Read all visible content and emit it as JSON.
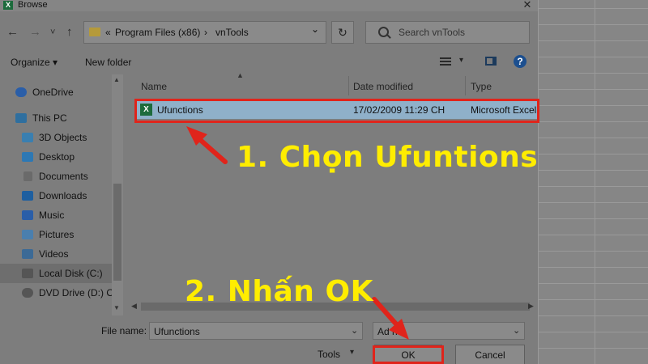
{
  "window": {
    "title": "Browse",
    "app_icon": "excel-icon",
    "close_glyph": "✕"
  },
  "nav": {
    "back": "←",
    "forward": "→",
    "recent": "˅",
    "up": "↑"
  },
  "address": {
    "prefix": "«",
    "crumbs": [
      "Program Files (x86)",
      "vnTools"
    ],
    "separator": "›",
    "dropdown": "⌄"
  },
  "refresh_glyph": "↻",
  "search": {
    "placeholder": "Search vnTools"
  },
  "toolbar": {
    "organize": "Organize ▾",
    "new_folder": "New folder",
    "help": "?"
  },
  "sidebar": {
    "items": [
      {
        "label": "OneDrive",
        "icon": "cloud-icon",
        "color": "#2a5ea8"
      },
      {
        "label": "This PC",
        "icon": "computer-icon",
        "color": "#2f6f9f"
      },
      {
        "label": "3D Objects",
        "icon": "cube-icon",
        "color": "#3a7fb0"
      },
      {
        "label": "Desktop",
        "icon": "desktop-icon",
        "color": "#2d78b4"
      },
      {
        "label": "Documents",
        "icon": "document-icon",
        "color": "#6a6a6a"
      },
      {
        "label": "Downloads",
        "icon": "download-icon",
        "color": "#1e5fa0"
      },
      {
        "label": "Music",
        "icon": "music-icon",
        "color": "#2a5ea8"
      },
      {
        "label": "Pictures",
        "icon": "pictures-icon",
        "color": "#4a7fae"
      },
      {
        "label": "Videos",
        "icon": "video-icon",
        "color": "#3c6a96"
      },
      {
        "label": "Local Disk (C:)",
        "icon": "disk-icon",
        "color": "#555555"
      },
      {
        "label": "DVD Drive (D:) O",
        "icon": "dvd-icon",
        "color": "#555555"
      }
    ],
    "selected": "Local Disk (C:)"
  },
  "file_list": {
    "columns": [
      "Name",
      "Date modified",
      "Type"
    ],
    "rows": [
      {
        "name": "Ufunctions",
        "date": "17/02/2009 11:29 CH",
        "type": "Microsoft Excel",
        "icon_text": "X"
      }
    ]
  },
  "bottom": {
    "file_name_label": "File name:",
    "file_name_value": "Ufunctions",
    "file_type_value": "Ad   ns",
    "tools": "Tools",
    "ok": "OK",
    "cancel": "Cancel"
  },
  "annotations": {
    "step1": "1. Chọn Ufuntions",
    "step2": "2. Nhấn OK",
    "color": "#ffed00",
    "highlight_color": "#e0241b"
  }
}
